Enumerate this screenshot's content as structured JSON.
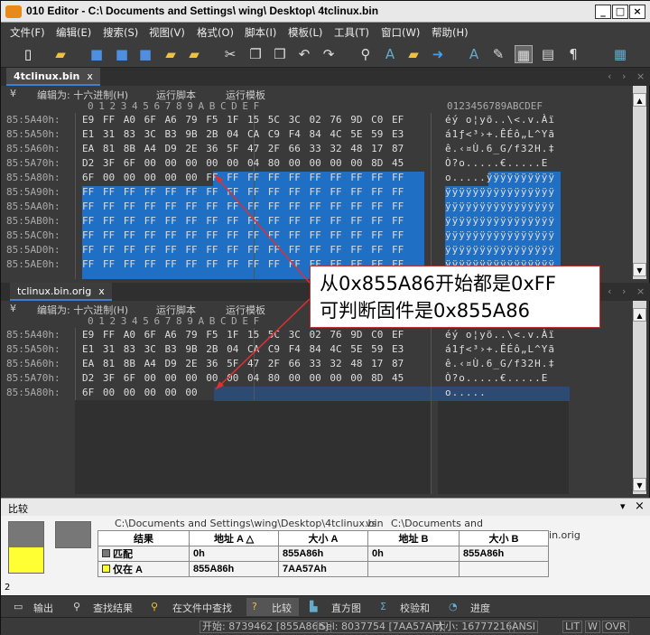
{
  "window": {
    "title": "010 Editor - C:\\ Documents and Settings\\ wing\\ Desktop\\ 4tclinux.bin"
  },
  "menu": [
    "文件(F)",
    "编辑(E)",
    "搜索(S)",
    "视图(V)",
    "格式(O)",
    "脚本(I)",
    "模板(L)",
    "工具(T)",
    "窗口(W)",
    "帮助(H)"
  ],
  "tabs": {
    "top": "4tclinux.bin",
    "bottom": "tclinux.bin.orig",
    "close": "x"
  },
  "editor_header": {
    "edit_as": "编辑为: 十六进制(H)",
    "run_script": "运行脚本",
    "run_template": "运行模板",
    "col_numbers": "0  1  2  3  4  5  6  7  8  9  A  B  C  D  E  F",
    "ascii_header": "0123456789ABCDEF"
  },
  "top_rows": [
    {
      "addr": "85:5A40h:",
      "hex": "E9 FF A0 6F A6 79 F5 1F 15 5C 3C 02 76 9D C0 EF",
      "ascii": "éý o¦yõ..\\<.v.Àï"
    },
    {
      "addr": "85:5A50h:",
      "hex": "E1 31 83 3C B3 9B 2B 04 CA C9 F4 84 4C 5E 59 E3",
      "ascii": "á1ƒ<³›+.ÊÉô„L^Yã"
    },
    {
      "addr": "85:5A60h:",
      "hex": "EA 81 8B A4 D9 2E 36 5F 47 2F 66 33 32 48 17 87",
      "ascii": "ê.‹¤Ù.6_G/f32H.‡"
    },
    {
      "addr": "85:5A70h:",
      "hex": "D2 3F 6F 00 00 00 00 00 04 80 00 00 00 00 8D 45",
      "ascii": "Ò?o.....€.....E"
    },
    {
      "addr": "85:5A80h:",
      "hex": "6F 00 00 00 00 00 FF FF FF FF FF FF FF FF FF FF",
      "ascii": "o.....ÿÿÿÿÿÿÿÿÿÿ"
    },
    {
      "addr": "85:5A90h:",
      "hex": "FF FF FF FF FF FF FF FF FF FF FF FF FF FF FF FF",
      "ascii": "ÿÿÿÿÿÿÿÿÿÿÿÿÿÿÿÿ"
    },
    {
      "addr": "85:5AA0h:",
      "hex": "FF FF FF FF FF FF FF FF FF FF FF FF FF FF FF FF",
      "ascii": "ÿÿÿÿÿÿÿÿÿÿÿÿÿÿÿÿ"
    },
    {
      "addr": "85:5AB0h:",
      "hex": "FF FF FF FF FF FF FF FF FF FF FF FF FF FF FF FF",
      "ascii": "ÿÿÿÿÿÿÿÿÿÿÿÿÿÿÿÿ"
    },
    {
      "addr": "85:5AC0h:",
      "hex": "FF FF FF FF FF FF FF FF FF FF FF FF FF FF FF FF",
      "ascii": "ÿÿÿÿÿÿÿÿÿÿÿÿÿÿÿÿ"
    },
    {
      "addr": "85:5AD0h:",
      "hex": "FF FF FF FF FF FF FF FF FF FF FF FF FF FF FF FF",
      "ascii": "ÿÿÿÿÿÿÿÿÿÿÿÿÿÿÿÿ"
    },
    {
      "addr": "85:5AE0h:",
      "hex": "FF FF FF FF FF FF FF FF FF FF FF FF FF FF FF FF",
      "ascii": "ÿÿÿÿÿÿÿÿÿÿÿÿÿÿÿÿ"
    }
  ],
  "bottom_rows": [
    {
      "addr": "85:5A40h:",
      "hex": "E9 FF A0 6F A6 79 F5 1F 15 5C 3C 02 76 9D C0 EF",
      "ascii": "éý o¦yõ..\\<.v.Àï"
    },
    {
      "addr": "85:5A50h:",
      "hex": "E1 31 83 3C B3 9B 2B 04 CA C9 F4 84 4C 5E 59 E3",
      "ascii": "á1ƒ<³›+.ÊÉô„L^Yã"
    },
    {
      "addr": "85:5A60h:",
      "hex": "EA 81 8B A4 D9 2E 36 5F 47 2F 66 33 32 48 17 87",
      "ascii": "ê.‹¤Ù.6_G/f32H.‡"
    },
    {
      "addr": "85:5A70h:",
      "hex": "D2 3F 6F 00 00 00 00 00 04 80 00 00 00 00 8D 45",
      "ascii": "Ò?o.....€.....E"
    },
    {
      "addr": "85:5A80h:",
      "hex": "6F 00 00 00 00 00",
      "ascii": "o....."
    }
  ],
  "callout": {
    "line1": "从0x855A86开始都是0xFF",
    "line2": "可判断固件是0x855A86"
  },
  "compare": {
    "panel_title": "比较",
    "file_a": "C:\\Documents and Settings\\wing\\Desktop\\4tclinux.bin",
    "vs": "vs.",
    "file_b": "C:\\Documents and Settings\\wing\\Desktop\\tclinux.bin.orig",
    "headers": [
      "结果",
      "地址 A",
      "大小 A",
      "地址 B",
      "大小 B"
    ],
    "rows": [
      {
        "result": "匹配",
        "addr_a": "0h",
        "size_a": "855A86h",
        "addr_b": "0h",
        "size_b": "855A86h"
      },
      {
        "result": "仅在 A",
        "addr_a": "855A86h",
        "size_a": "7AA57Ah",
        "addr_b": "",
        "size_b": ""
      }
    ],
    "count": "2"
  },
  "bottom_tabs": [
    "输出",
    "查找结果",
    "在文件中查找",
    "比较",
    "直方图",
    "校验和",
    "进度"
  ],
  "status": {
    "start": "开始: 8739462 [855A86h]",
    "sel": "Sel: 8037754 [7AA57Ah]",
    "size": "大小: 16777216",
    "encoding": "ANSI",
    "lit": "LIT",
    "w": "W",
    "ovr": "OVR"
  },
  "colors": {
    "selection": "#1f6fc4",
    "only_a": "#ffff33",
    "match": "#777777"
  }
}
